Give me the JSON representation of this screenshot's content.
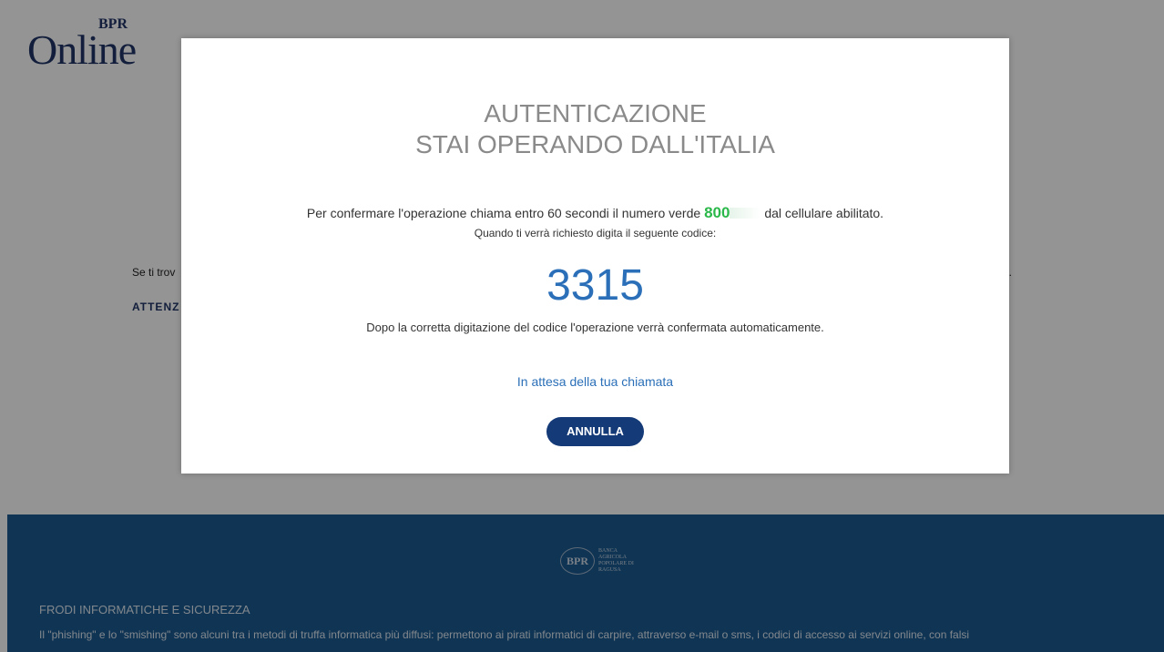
{
  "header": {
    "logo_text": "Online",
    "logo_badge": "BPR"
  },
  "background": {
    "info_text": "Se ti trov",
    "warning_text": "ATTENZ",
    "trailing_text": "."
  },
  "footer": {
    "logo_badge": "BPR",
    "logo_caption": "BANCA AGRICOLA POPOLARE DI RAGUSA",
    "section_title": "FRODI INFORMATICHE E SICUREZZA",
    "section_text": "Il \"phishing\" e lo \"smishing\" sono alcuni tra i metodi di truffa informatica più diffusi: permettono ai pirati informatici di carpire, attraverso e-mail o sms, i codici di accesso ai servizi online, con falsi"
  },
  "modal": {
    "title": "AUTENTICAZIONE",
    "subtitle": "STAI OPERANDO DALL'ITALIA",
    "instruction_before": "Per confermare l'operazione chiama entro 60 secondi il numero verde",
    "phone_visible": "800",
    "instruction_after": "dal cellulare abilitato.",
    "code_prompt": "Quando ti verrà richiesto digita il seguente codice:",
    "code": "3315",
    "confirm_note": "Dopo la corretta digitazione del codice l'operazione verrà confermata automaticamente.",
    "waiting_text": "In attesa della tua chiamata",
    "cancel_label": "ANNULLA"
  },
  "colors": {
    "overlay": "#000000",
    "footer_bg": "#1a5a91",
    "code_blue": "#2a6fb8",
    "phone_green": "#2bb84a",
    "button_bg": "#153a78"
  }
}
